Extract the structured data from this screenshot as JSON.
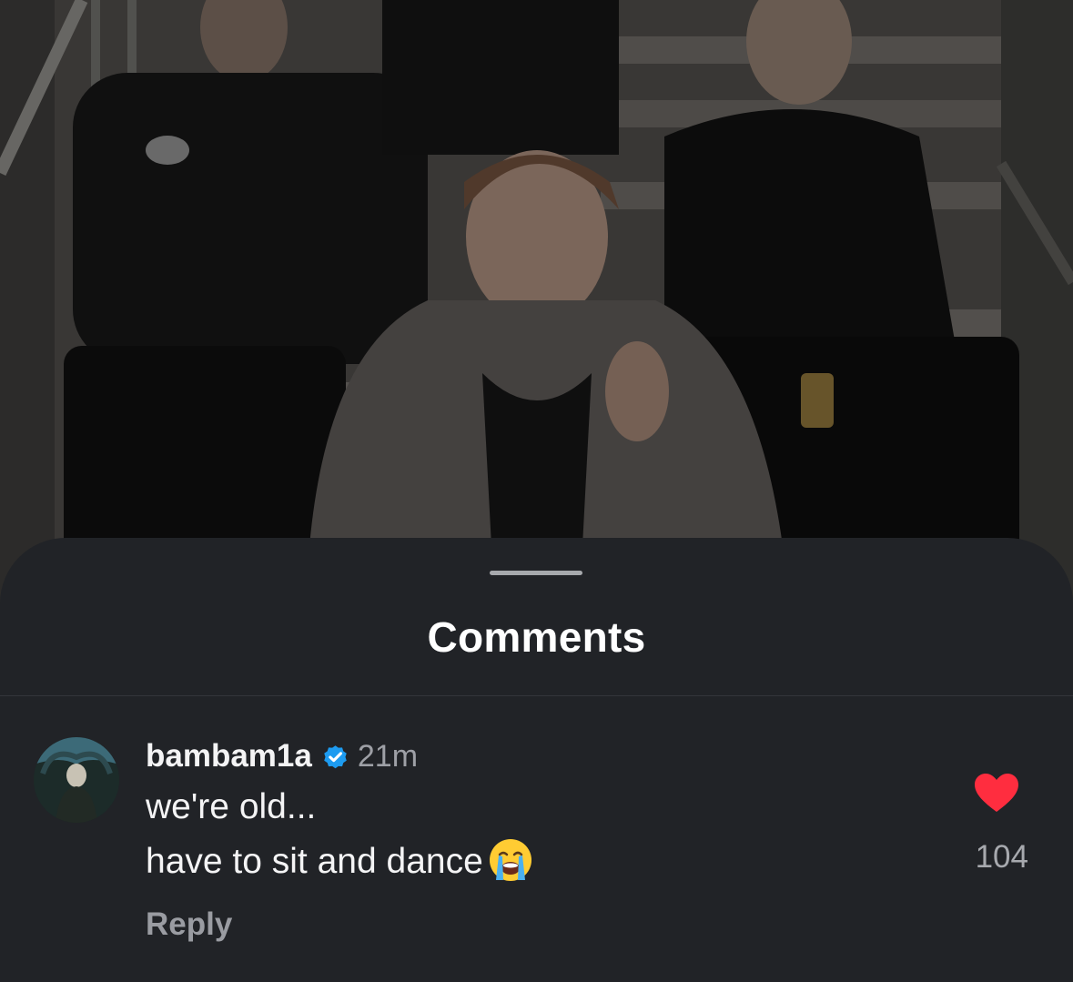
{
  "background": {
    "description_icon": "video-frame"
  },
  "sheet": {
    "title": "Comments"
  },
  "comment": {
    "username": "bambam1a",
    "verified_icon": "verified-badge-icon",
    "timestamp": "21m",
    "lines": [
      "we're old...",
      "have to sit and dance"
    ],
    "emoji": "loudly-crying-face",
    "reply_label": "Reply",
    "like_icon": "heart-icon",
    "like_count": "104",
    "liked": true
  },
  "colors": {
    "sheet_bg": "#212327",
    "heart": "#ff2d3f",
    "verified": "#1d9bf0",
    "secondary_text": "#9ea0a6"
  }
}
